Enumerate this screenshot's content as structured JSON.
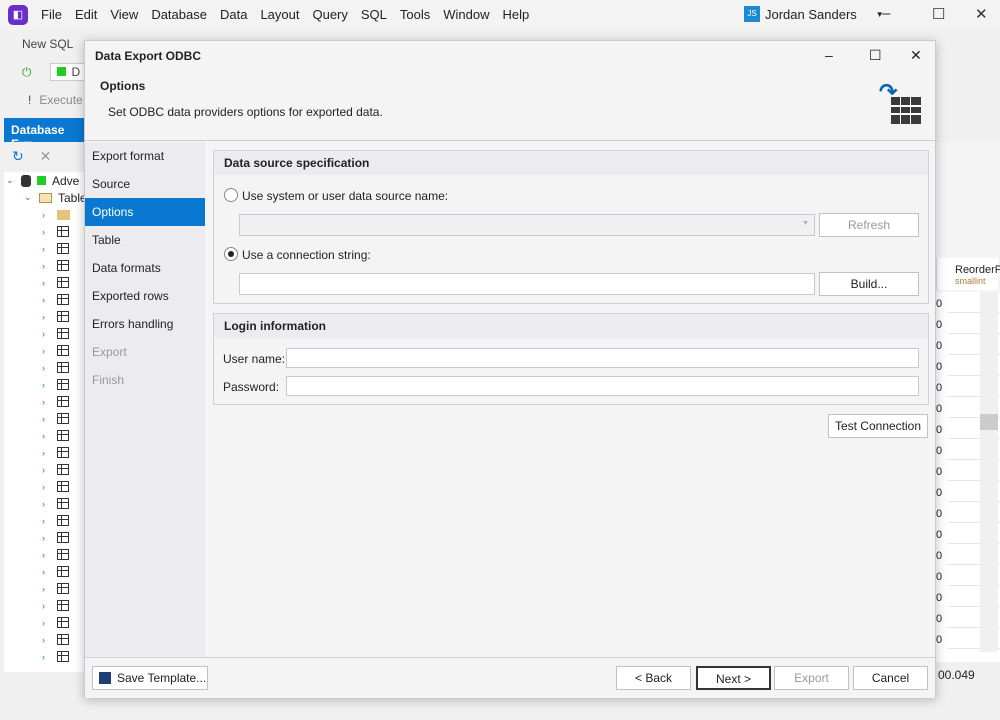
{
  "app": {
    "menu": [
      "File",
      "Edit",
      "View",
      "Database",
      "Data",
      "Layout",
      "Query",
      "SQL",
      "Tools",
      "Window",
      "Help"
    ],
    "user_initials": "JS",
    "user_name": "Jordan  Sanders"
  },
  "toolbar": {
    "new_sql": "New SQL",
    "execute": "Execute",
    "db_conn": "D"
  },
  "db_explorer": {
    "title": "Database Exp",
    "root": "Adve",
    "tables": "Table"
  },
  "grid": {
    "column": "ReorderP",
    "column_type": "smallint",
    "value": "0",
    "status": "00.049"
  },
  "dialog": {
    "title": "Data Export ODBC",
    "page_title": "Options",
    "page_desc": "Set ODBC data providers options for exported data.",
    "nav": [
      {
        "label": "Export format",
        "state": "normal"
      },
      {
        "label": "Source",
        "state": "normal"
      },
      {
        "label": "Options",
        "state": "selected"
      },
      {
        "label": "Table",
        "state": "normal"
      },
      {
        "label": "Data formats",
        "state": "normal"
      },
      {
        "label": "Exported rows",
        "state": "normal"
      },
      {
        "label": "Errors handling",
        "state": "normal"
      },
      {
        "label": "Export",
        "state": "disabled"
      },
      {
        "label": "Finish",
        "state": "disabled"
      }
    ],
    "ds_group": "Data source specification",
    "radio_dsn": "Use system or user data source name:",
    "radio_conn": "Use a connection string:",
    "selected_radio": "connection_string",
    "dsn_value": "",
    "conn_value": "",
    "refresh": "Refresh",
    "build": "Build...",
    "login_group": "Login information",
    "user_label": "User name:",
    "user_value": "",
    "password_label": "Password:",
    "password_value": "",
    "test_connection": "Test Connection",
    "save_template": "Save Template...",
    "back": "< Back",
    "next": "Next >",
    "export": "Export",
    "cancel": "Cancel"
  },
  "colors": {
    "accent": "#0a78d0",
    "brand": "#6b2fc9"
  }
}
